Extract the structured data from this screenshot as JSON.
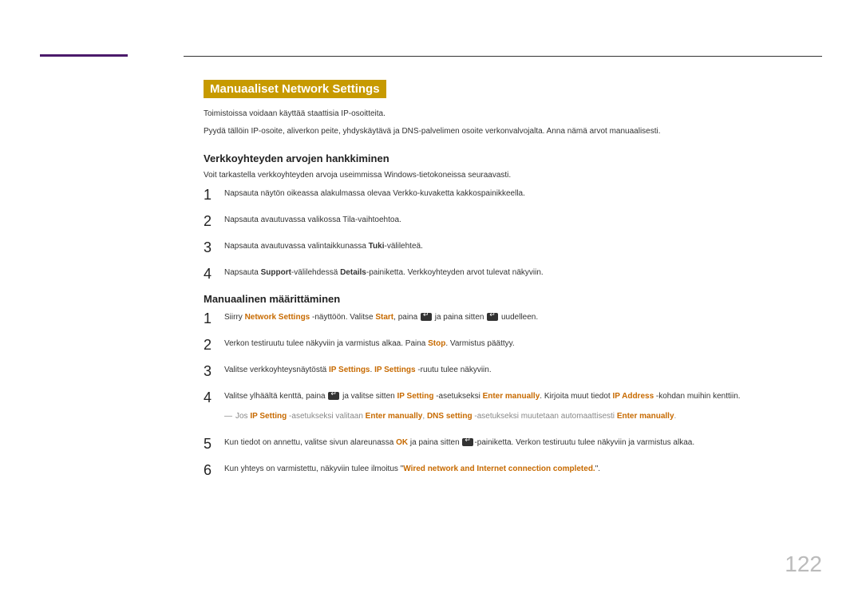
{
  "page_number": "122",
  "section_title": "Manuaaliset Network Settings",
  "intro1": "Toimistoissa voidaan käyttää staattisia IP-osoitteita.",
  "intro2": "Pyydä tällöin IP-osoite, aliverkon peite, yhdyskäytävä ja DNS-palvelimen osoite verkonvalvojalta. Anna nämä arvot manuaalisesti.",
  "sub1_title": "Verkkoyhteyden arvojen hankkiminen",
  "sub1_intro": "Voit tarkastella verkkoyhteyden arvoja useimmissa Windows-tietokoneissa seuraavasti.",
  "sub1_steps": {
    "s1": "Napsauta näytön oikeassa alakulmassa olevaa Verkko-kuvaketta kakkospainikkeella.",
    "s2": "Napsauta avautuvassa valikossa Tila-vaihtoehtoa.",
    "s3_a": "Napsauta avautuvassa valintaikkunassa ",
    "s3_b": "Tuki",
    "s3_c": "-välilehteä.",
    "s4_a": "Napsauta ",
    "s4_b": "Support",
    "s4_c": "-välilehdessä ",
    "s4_d": "Details",
    "s4_e": "-painiketta. Verkkoyhteyden arvot tulevat näkyviin."
  },
  "sub2_title": "Manuaalinen määrittäminen",
  "sub2_steps": {
    "s1_a": "Siirry ",
    "s1_b": "Network Settings",
    "s1_c": " -näyttöön. Valitse ",
    "s1_d": "Start",
    "s1_e": ", paina ",
    "s1_f": " ja paina sitten ",
    "s1_g": " uudelleen.",
    "s2_a": "Verkon testiruutu tulee näkyviin ja varmistus alkaa. Paina ",
    "s2_b": "Stop",
    "s2_c": ". Varmistus päättyy.",
    "s3_a": "Valitse verkkoyhteysnäytöstä ",
    "s3_b": "IP Settings",
    "s3_c": ". ",
    "s3_d": "IP Settings",
    "s3_e": " -ruutu tulee näkyviin.",
    "s4_a": "Valitse ylhäältä kenttä, paina ",
    "s4_b": " ja valitse sitten ",
    "s4_c": "IP Setting",
    "s4_d": " -asetukseksi ",
    "s4_e": "Enter manually",
    "s4_f": ". Kirjoita muut tiedot ",
    "s4_g": "IP Address",
    "s4_h": " -kohdan muihin kenttiin.",
    "note_a": "Jos ",
    "note_b": "IP Setting",
    "note_c": " -asetukseksi valitaan ",
    "note_d": "Enter manually",
    "note_e": ", ",
    "note_f": "DNS setting",
    "note_g": " -asetukseksi muutetaan automaattisesti ",
    "note_h": "Enter manually",
    "note_i": ".",
    "s5_a": "Kun tiedot on annettu, valitse sivun alareunassa ",
    "s5_b": "OK",
    "s5_c": " ja paina sitten ",
    "s5_d": "-painiketta. Verkon testiruutu tulee näkyviin ja varmistus alkaa.",
    "s6_a": "Kun yhteys on varmistettu, näkyviin tulee ilmoitus \"",
    "s6_b": "Wired network and Internet connection completed.",
    "s6_c": "\"."
  }
}
